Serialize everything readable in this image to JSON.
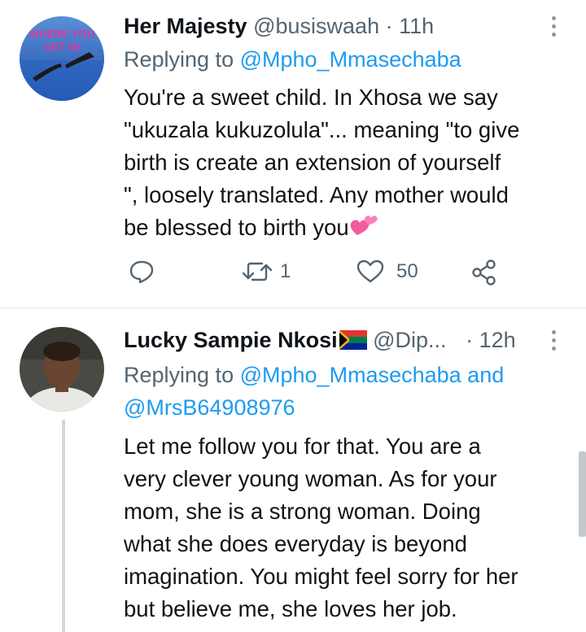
{
  "tweets": [
    {
      "display_name": "Her Majesty",
      "handle": "@busiswaah",
      "separator": "·",
      "time": "11h",
      "replying_prefix": "Replying to",
      "replying_to": "@Mpho_Mmasechaba",
      "avatar_text_line1": "WHERE YOU",
      "avatar_text_line2": "GET 60",
      "text_lines": [
        "You're a sweet child. In Xhosa we say",
        "\"ukuzala kukuzolula\"... meaning \"to give",
        "birth is create an extension of yourself",
        "\", loosely translated. Any mother would",
        "be blessed to birth you"
      ],
      "emoji": "two-hearts",
      "retweet_count": "1",
      "like_count": "50"
    },
    {
      "display_name": "Lucky Sampie Nkosi",
      "flag_emoji": "south-africa-flag",
      "handle": "@Dip...",
      "separator": "·",
      "time": "12h",
      "replying_prefix": "Replying to",
      "replying_to": "@Mpho_Mmasechaba",
      "replying_and": "and",
      "replying_to_2": "@MrsB64908976",
      "text_lines": [
        "Let me follow you for that. You are a",
        "very clever young woman. As for your",
        "mom, she is a strong woman. Doing",
        "what she does everyday is beyond",
        "imagination. You might feel sorry for her",
        "but believe me, she loves her job."
      ]
    }
  ],
  "colors": {
    "text": "#0f1419",
    "secondary": "#536471",
    "link": "#1d9bf0",
    "divider": "#eff3f4",
    "thread_line": "#cfd9de"
  }
}
